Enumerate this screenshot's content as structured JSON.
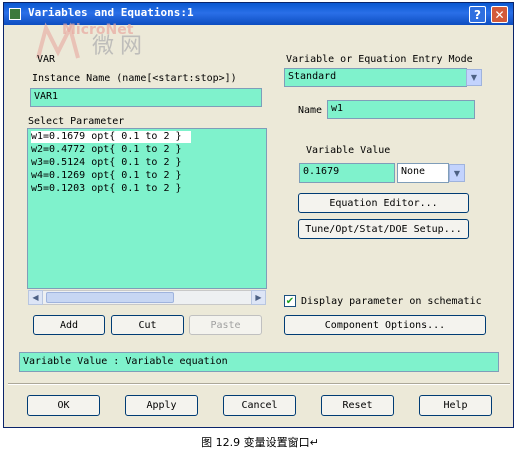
{
  "window": {
    "title": "Variables and Equations:1"
  },
  "watermark": {
    "brand_text": "MicroNet",
    "cn_text": "微网"
  },
  "component": {
    "type": "VAR",
    "instance_label": "Instance Name  (name[<start:stop>])",
    "instance_value": "VAR1"
  },
  "parameters": {
    "label": "Select Parameter",
    "items": [
      "w1=0.1679 opt{ 0.1 to 2 }",
      "w2=0.4772 opt{ 0.1 to 2 }",
      "w3=0.5124 opt{ 0.1 to 2 }",
      "w4=0.1269 opt{ 0.1 to 2 }",
      "w5=0.1203 opt{ 0.1 to 2 }"
    ],
    "buttons": {
      "add": "Add",
      "cut": "Cut",
      "paste": "Paste"
    }
  },
  "entry_mode": {
    "label": "Variable or Equation Entry Mode",
    "value": "Standard"
  },
  "name_field": {
    "label": "Name",
    "value": "w1"
  },
  "variable_value": {
    "label": "Variable Value",
    "value": "0.1679",
    "unit": "None"
  },
  "buttons": {
    "equation_editor": "Equation Editor...",
    "tune_setup": "Tune/Opt/Stat/DOE Setup...",
    "component_options": "Component Options..."
  },
  "display_param": {
    "label": "Display parameter on schematic",
    "checked": true
  },
  "status": {
    "text": "Variable Value : Variable equation"
  },
  "footer": {
    "ok": "OK",
    "apply": "Apply",
    "cancel": "Cancel",
    "reset": "Reset",
    "help": "Help"
  },
  "caption": "图 12.9  变量设置窗口↵",
  "colors": {
    "field_bg": "#7ff2cc",
    "titlebar": "#0a58d0",
    "dialog_bg": "#ece9d8"
  }
}
